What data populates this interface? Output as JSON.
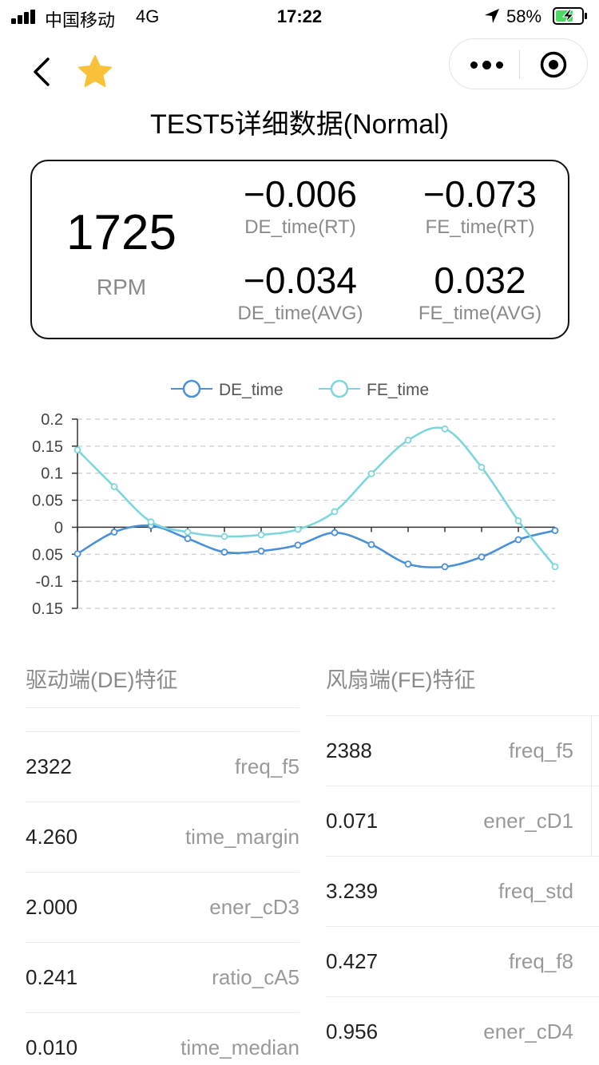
{
  "status_bar": {
    "carrier": "中国移动",
    "network": "4G",
    "time": "17:22",
    "battery": "58%"
  },
  "nav": {
    "title": "TEST5详细数据(Normal)"
  },
  "summary": {
    "rpm_value": "1725",
    "rpm_label": "RPM",
    "metrics": [
      {
        "value": "−0.006",
        "label": "DE_time(RT)"
      },
      {
        "value": "−0.073",
        "label": "FE_time(RT)"
      },
      {
        "value": "−0.034",
        "label": "DE_time(AVG)"
      },
      {
        "value": "0.032",
        "label": "FE_time(AVG)"
      }
    ]
  },
  "chart_data": {
    "type": "line",
    "legend": [
      "DE_time",
      "FE_time"
    ],
    "legend_position": "top-center",
    "y_ticks": [
      "0.2",
      "0.15",
      "0.1",
      "0.05",
      "0",
      "0.05",
      "-0.1",
      "0.15"
    ],
    "ylim": [
      -0.15,
      0.2
    ],
    "grid": "dashed-horizontal",
    "x_count": 14,
    "series": [
      {
        "name": "DE_time",
        "color": "#4a90d9",
        "values": [
          -0.049,
          -0.009,
          0.003,
          -0.021,
          -0.046,
          -0.044,
          -0.033,
          -0.01,
          -0.032,
          -0.068,
          -0.073,
          -0.055,
          -0.023,
          -0.006
        ]
      },
      {
        "name": "FE_time",
        "color": "#7dd6dc",
        "values": [
          0.143,
          0.075,
          0.01,
          -0.009,
          -0.017,
          -0.014,
          -0.004,
          0.029,
          0.099,
          0.161,
          0.182,
          0.111,
          0.012,
          -0.073
        ]
      }
    ]
  },
  "de_features": {
    "title": "驱动端(DE)特征",
    "rows": [
      {
        "value": "2322",
        "key": "freq_f5"
      },
      {
        "value": "4.260",
        "key": "time_margin"
      },
      {
        "value": "2.000",
        "key": "ener_cD3"
      },
      {
        "value": "0.241",
        "key": "ratio_cA5"
      },
      {
        "value": "0.010",
        "key": "time_median"
      }
    ]
  },
  "fe_features": {
    "title": "风扇端(FE)特征",
    "rows": [
      {
        "value": "2388",
        "key": "freq_f5"
      },
      {
        "value": "0.071",
        "key": "ener_cD1"
      },
      {
        "value": "3.239",
        "key": "freq_std"
      },
      {
        "value": "0.427",
        "key": "freq_f8"
      },
      {
        "value": "0.956",
        "key": "ener_cD4"
      }
    ]
  }
}
